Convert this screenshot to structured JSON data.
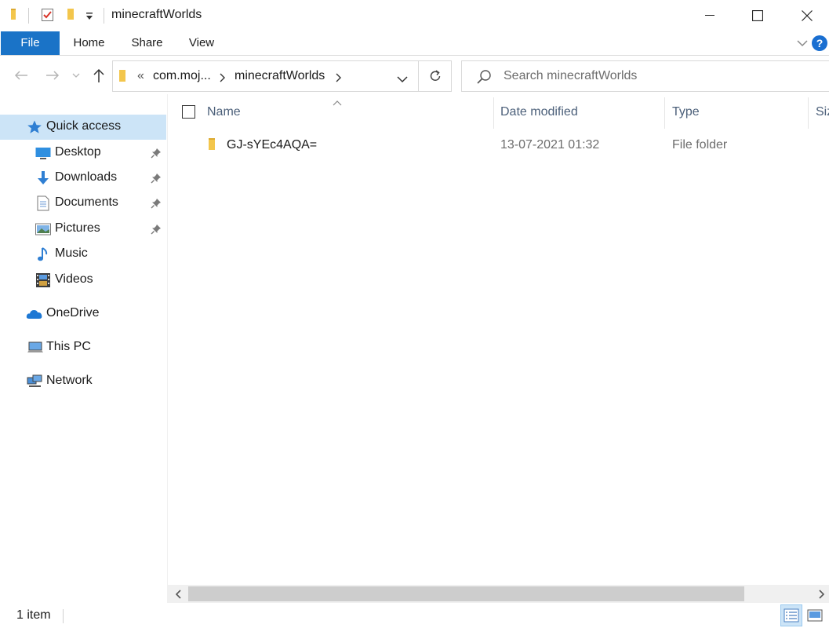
{
  "window": {
    "title": "minecraftWorlds",
    "minimize_glyph": "—",
    "maximize_glyph": "☐",
    "close_glyph": "✕"
  },
  "ribbon": {
    "tabs": [
      {
        "label": "File"
      },
      {
        "label": "Home"
      },
      {
        "label": "Share"
      },
      {
        "label": "View"
      }
    ],
    "help_glyph": "?"
  },
  "address": {
    "overflow_glyph": "«",
    "crumbs": [
      {
        "label": "com.moj..."
      },
      {
        "label": "minecraftWorlds"
      }
    ]
  },
  "search": {
    "placeholder": "Search minecraftWorlds"
  },
  "sidebar": {
    "quick_access": "Quick access",
    "items": [
      {
        "label": "Desktop",
        "icon": "desktop-icon",
        "pinned": true
      },
      {
        "label": "Downloads",
        "icon": "downloads-icon",
        "pinned": true
      },
      {
        "label": "Documents",
        "icon": "documents-icon",
        "pinned": true
      },
      {
        "label": "Pictures",
        "icon": "pictures-icon",
        "pinned": true
      },
      {
        "label": "Music",
        "icon": "music-icon",
        "pinned": false
      },
      {
        "label": "Videos",
        "icon": "videos-icon",
        "pinned": false
      }
    ],
    "onedrive": "OneDrive",
    "this_pc": "This PC",
    "network": "Network"
  },
  "columns": [
    {
      "label": "Name"
    },
    {
      "label": "Date modified"
    },
    {
      "label": "Type"
    },
    {
      "label": "Siz"
    }
  ],
  "files": [
    {
      "name": "GJ-sYEc4AQA=",
      "date_modified": "13-07-2021 01:32",
      "type": "File folder"
    }
  ],
  "status": {
    "item_count": "1 item"
  },
  "colors": {
    "accent": "#1a73c7",
    "selection": "#cce4f7",
    "folder": "#f3c64c"
  }
}
